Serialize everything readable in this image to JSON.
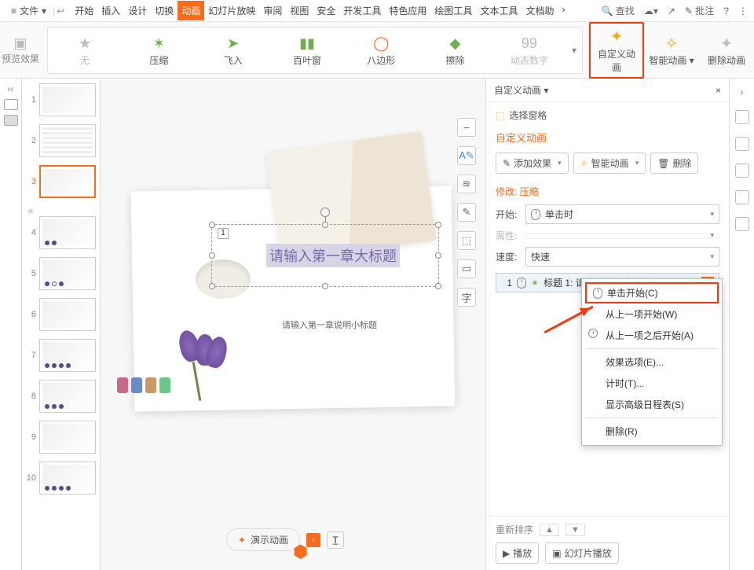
{
  "menubar": {
    "file": "文件",
    "tabs": [
      "开始",
      "插入",
      "设计",
      "切换",
      "动画",
      "幻灯片放映",
      "审阅",
      "视图",
      "安全",
      "开发工具",
      "特色应用",
      "绘图工具",
      "文本工具",
      "文档助"
    ],
    "active_index": 4,
    "search": "查找",
    "annotate": "批注"
  },
  "ribbon": {
    "preview": "预览效果",
    "gallery": [
      {
        "label": "无",
        "dim": true
      },
      {
        "label": "压缩"
      },
      {
        "label": "飞入"
      },
      {
        "label": "百叶窗"
      },
      {
        "label": "八边形"
      },
      {
        "label": "擦除"
      },
      {
        "label": "动态数字",
        "dim": true
      }
    ],
    "custom_anim": "自定义动画",
    "smart_anim": "智能动画",
    "delete_anim": "删除动画"
  },
  "thumbnails": {
    "count": 10,
    "active": 3
  },
  "slide": {
    "number_tag": "1",
    "title": "请输入第一章大标题",
    "subtitle": "请输入第一章说明小标题",
    "demo_button": "演示动画"
  },
  "panel": {
    "header": "自定义动画",
    "select_pane": "选择窗格",
    "title": "自定义动画",
    "buttons": {
      "add": "添加效果",
      "smart": "智能动画",
      "delete": "删除"
    },
    "modify_label": "修改: 压缩",
    "props": {
      "start_label": "开始:",
      "start_value": "单击时",
      "prop_label": "属性:",
      "speed_label": "速度:",
      "speed_value": "快速"
    },
    "anim_item": {
      "index": "1",
      "text": "标题 1: 请输入第一章大标题"
    },
    "context_menu": [
      "单击开始(C)",
      "从上一项开始(W)",
      "从上一项之后开始(A)",
      "效果选项(E)...",
      "计时(T)...",
      "显示高级日程表(S)",
      "删除(R)"
    ],
    "footer": {
      "reorder": "重新排序",
      "play": "播放",
      "slideshow": "幻灯片播放"
    }
  }
}
